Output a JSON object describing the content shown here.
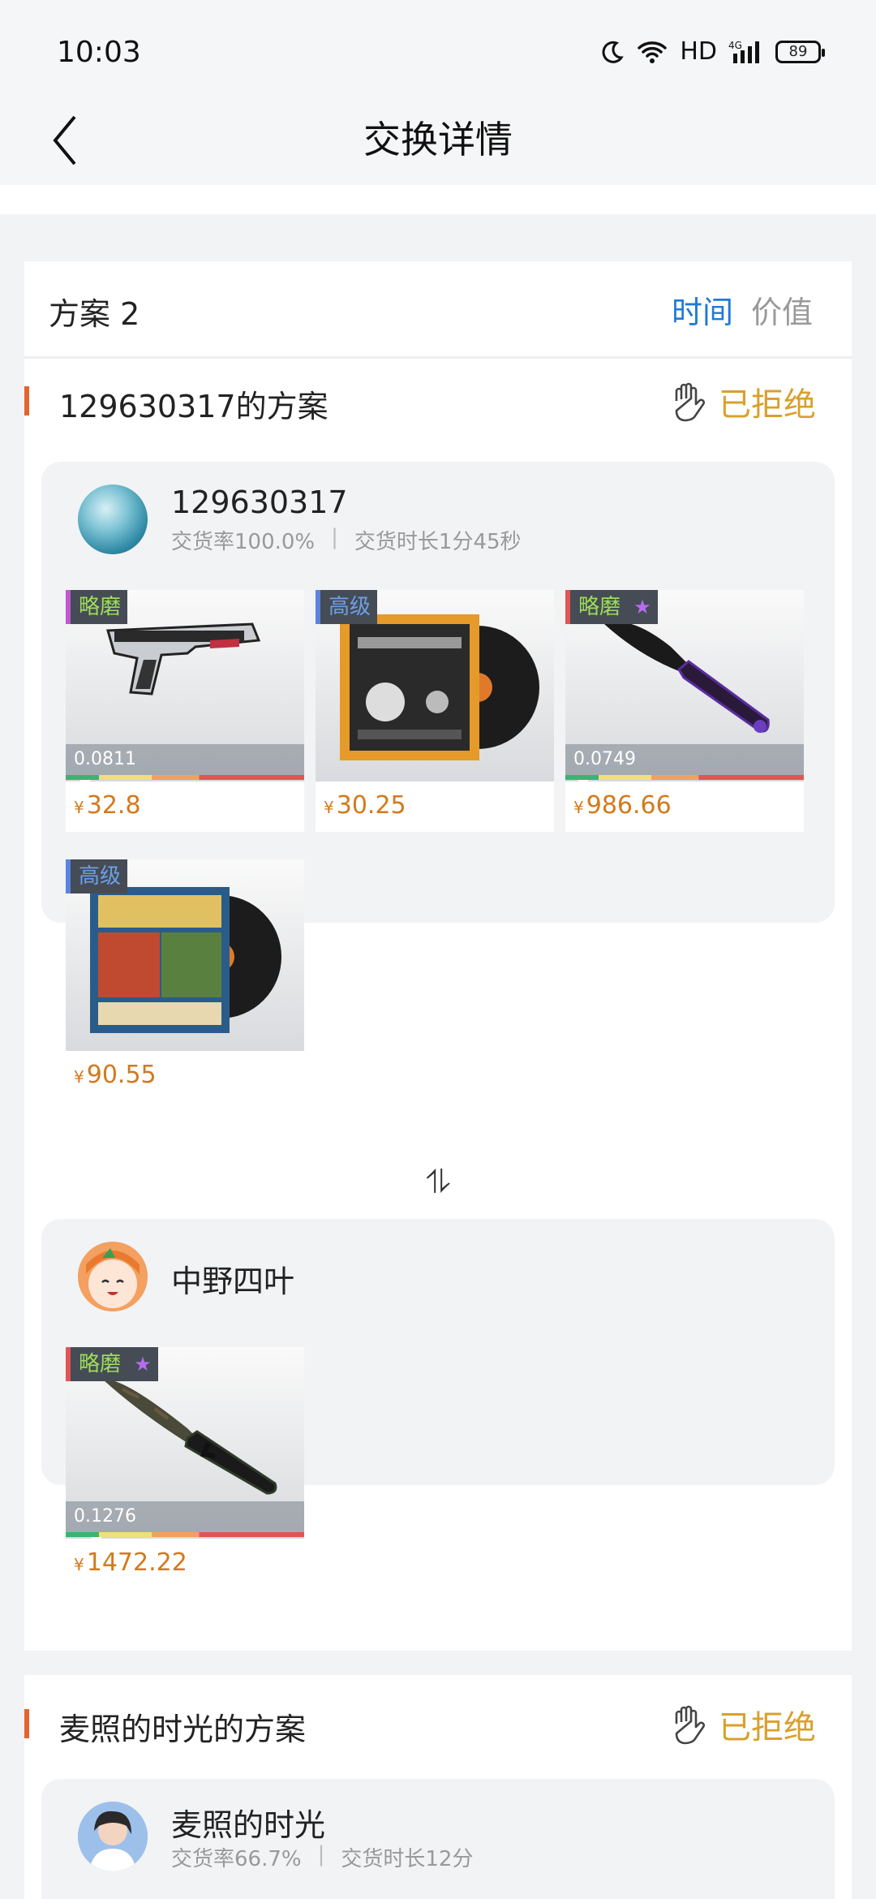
{
  "status_bar": {
    "time": "10:03",
    "network": "HD",
    "signal_label": "4G",
    "battery": "89"
  },
  "nav": {
    "title": "交换详情"
  },
  "plan": {
    "title": "方案 2",
    "sort_time": "时间",
    "sort_value": "价值"
  },
  "offer1": {
    "title": "129630317的方案",
    "status": "已拒绝",
    "initiator": {
      "name": "129630317",
      "rate": "交货率100.0%",
      "duration": "交货时长1分45秒",
      "items": [
        {
          "grade": "略磨",
          "float": "0.0811",
          "price": "32.8",
          "currency": "¥",
          "wear_fraction": 0.0811
        },
        {
          "grade": "高级",
          "price": "30.25",
          "currency": "¥"
        },
        {
          "grade": "略磨",
          "star": "★",
          "float": "0.0749",
          "price": "986.66",
          "currency": "¥",
          "wear_fraction": 0.0749
        },
        {
          "grade": "高级",
          "price": "90.55",
          "currency": "¥"
        }
      ]
    },
    "swap_icon": "⥮",
    "receiver": {
      "name": "中野四叶",
      "items": [
        {
          "grade": "略磨",
          "star": "★",
          "float": "0.1276",
          "price": "1472.22",
          "currency": "¥",
          "wear_fraction": 0.1276
        }
      ]
    }
  },
  "offer2": {
    "title": "麦照的时光的方案",
    "status": "已拒绝",
    "initiator": {
      "name": "麦照的时光",
      "rate": "交货率66.7%",
      "duration": "交货时长12分"
    }
  },
  "colors": {
    "accent": "#e5632e",
    "status": "#d9a02b",
    "price": "#d4791c",
    "tab_active": "#1e7ad8"
  }
}
